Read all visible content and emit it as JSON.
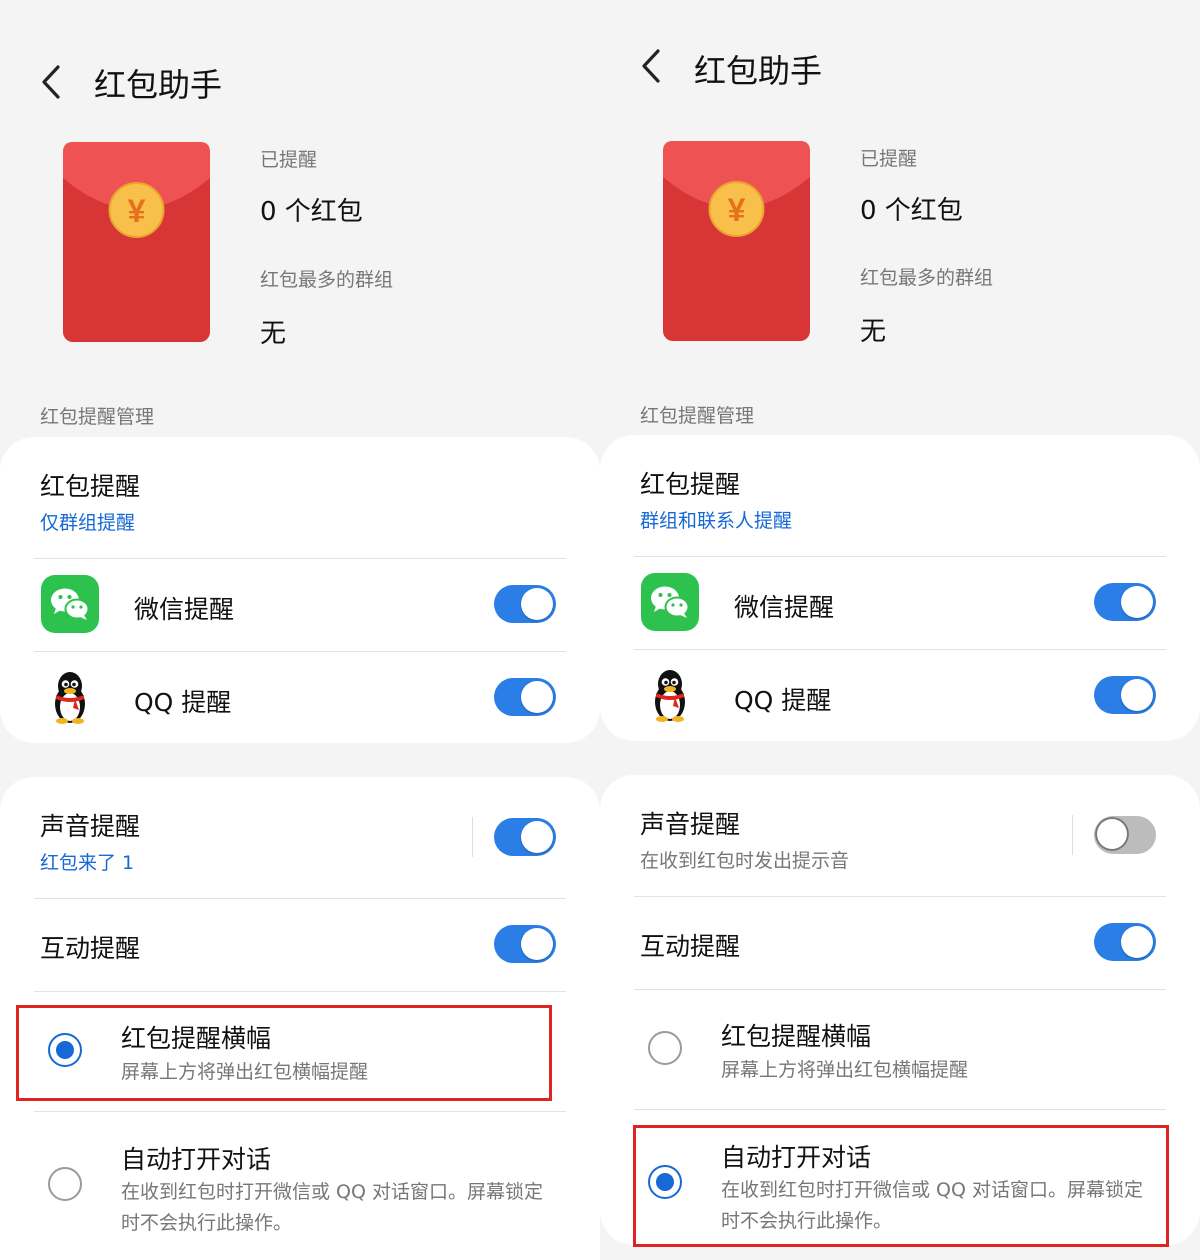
{
  "panels": [
    {
      "title": "红包助手",
      "stats": {
        "reminded_label": "已提醒",
        "reminded_value": "0 个红包",
        "top_group_label": "红包最多的群组",
        "top_group_value": "无"
      },
      "section_title": "红包提醒管理",
      "envelope_symbol": "¥",
      "red_packet_reminder": {
        "title": "红包提醒",
        "subtitle": "仅群组提醒"
      },
      "apps": [
        {
          "label": "微信提醒",
          "on": true
        },
        {
          "label": "QQ 提醒",
          "on": true
        }
      ],
      "sound": {
        "title": "声音提醒",
        "subtitle": "红包来了 1",
        "on": true
      },
      "interaction": {
        "title": "互动提醒",
        "on": true
      },
      "options": [
        {
          "title": "红包提醒横幅",
          "desc": "屏幕上方将弹出红包横幅提醒",
          "selected": true
        },
        {
          "title": "自动打开对话",
          "desc": "在收到红包时打开微信或 QQ 对话窗口。屏幕锁定时不会执行此操作。",
          "selected": false
        }
      ]
    },
    {
      "title": "红包助手",
      "stats": {
        "reminded_label": "已提醒",
        "reminded_value": "0 个红包",
        "top_group_label": "红包最多的群组",
        "top_group_value": "无"
      },
      "section_title": "红包提醒管理",
      "envelope_symbol": "¥",
      "red_packet_reminder": {
        "title": "红包提醒",
        "subtitle": "群组和联系人提醒"
      },
      "apps": [
        {
          "label": "微信提醒",
          "on": true
        },
        {
          "label": "QQ 提醒",
          "on": true
        }
      ],
      "sound": {
        "title": "声音提醒",
        "subtitle": "在收到红包时发出提示音",
        "on": false
      },
      "interaction": {
        "title": "互动提醒",
        "on": true
      },
      "options": [
        {
          "title": "红包提醒横幅",
          "desc": "屏幕上方将弹出红包横幅提醒",
          "selected": false
        },
        {
          "title": "自动打开对话",
          "desc": "在收到红包时打开微信或 QQ 对话窗口。屏幕锁定时不会执行此操作。",
          "selected": true
        }
      ]
    }
  ],
  "colors": {
    "accent": "#1769d6",
    "toggle_on": "#2a7ee6",
    "envelope": "#dd3b3b",
    "highlight": "#e02424"
  }
}
